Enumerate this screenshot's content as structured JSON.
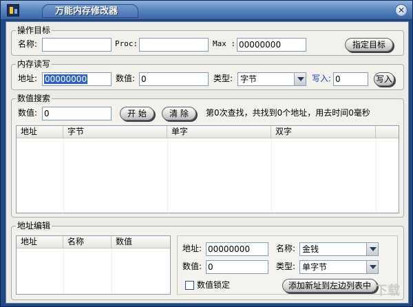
{
  "window": {
    "title": "万能内存修改器",
    "close_glyph": "✕"
  },
  "target": {
    "legend": "操作目标",
    "name_label": "名称:",
    "name_value": "",
    "proc_label": "Proc:",
    "proc_value": "",
    "max_label": "Max :",
    "max_value": "00000000",
    "assign_button": "指定目标"
  },
  "memrw": {
    "legend": "内存读写",
    "addr_label": "地址:",
    "addr_value": "00000000",
    "value_label": "数值:",
    "value_value": "0",
    "type_label": "类型:",
    "type_value": "字节",
    "write_label": "写入:",
    "write_value": "0",
    "write_button": "写入"
  },
  "search": {
    "legend": "数值搜索",
    "value_label": "数值:",
    "value_value": "0",
    "start_button": "开 始",
    "clear_button": "清 除",
    "status": "第0次查找，共找到0个地址，用去时间0毫秒",
    "columns": [
      "地址",
      "字节",
      "单字",
      "双字"
    ]
  },
  "addr_edit": {
    "legend": "地址编辑",
    "columns": [
      "地址",
      "名称",
      "数值"
    ],
    "addr_label": "地址:",
    "addr_value": "00000000",
    "name_label": "名称:",
    "name_value": "金钱",
    "value_label": "数值:",
    "value_value": "0",
    "type_label": "类型:",
    "type_value": "单字节",
    "lock_label": "数值锁定",
    "lock_checked": false,
    "add_button": "添加新址到左边列表中"
  },
  "watermark": "下载"
}
